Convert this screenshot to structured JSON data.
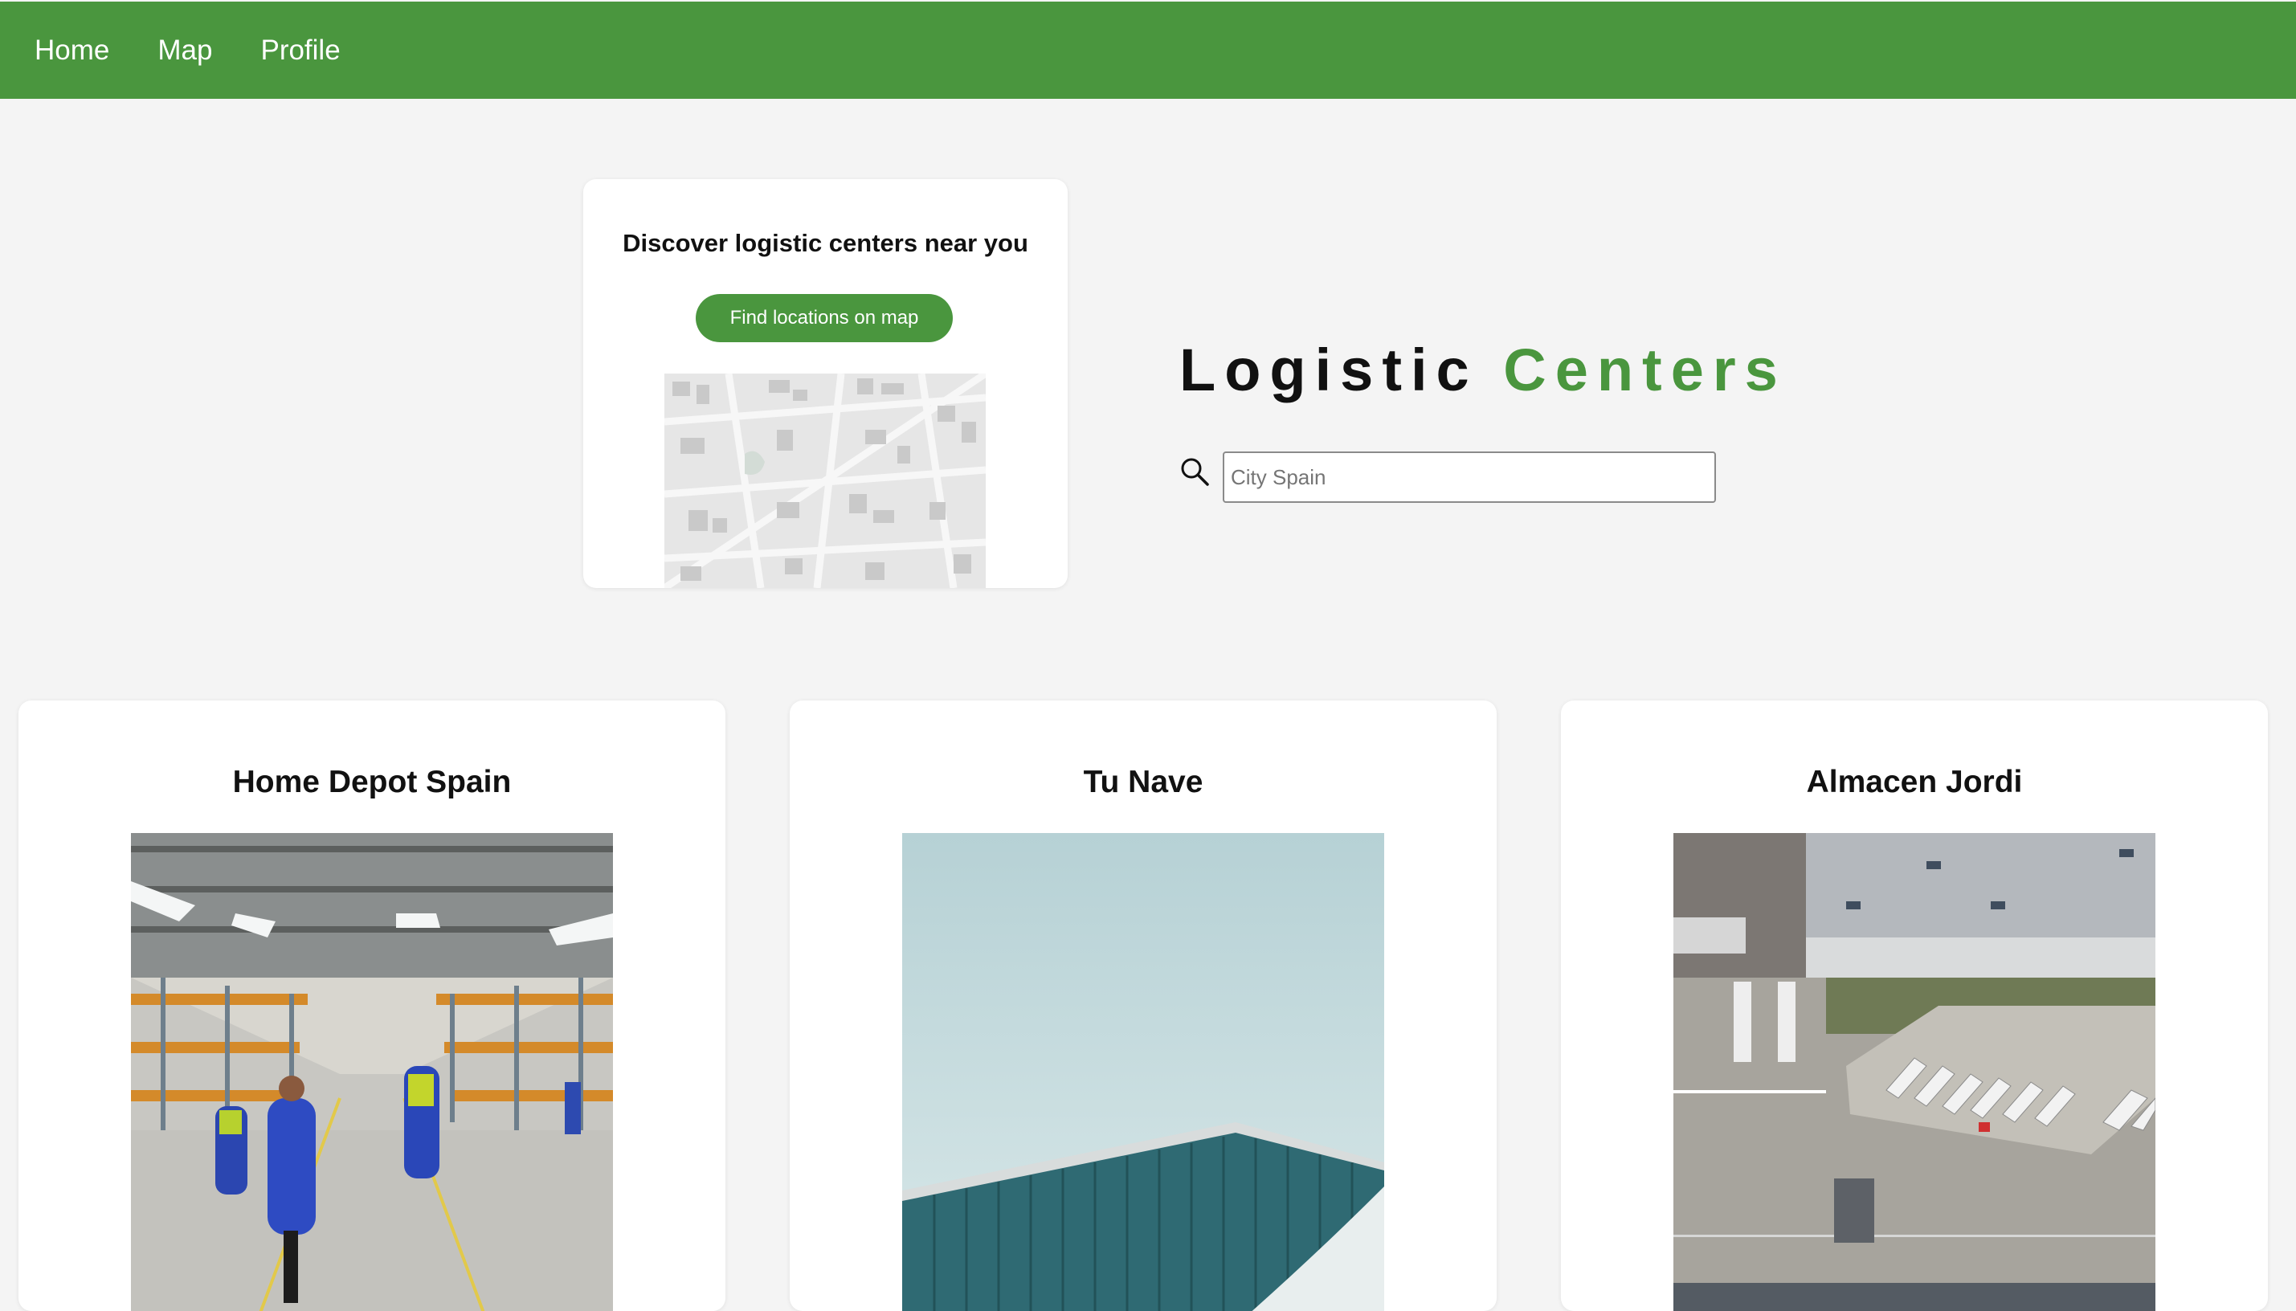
{
  "nav": {
    "items": [
      {
        "label": "Home"
      },
      {
        "label": "Map"
      },
      {
        "label": "Profile"
      }
    ]
  },
  "promo": {
    "title": "Discover logistic centers near you",
    "button_label": "Find locations on map"
  },
  "hero": {
    "title_dark": "Logistic",
    "title_green": "Centers"
  },
  "search": {
    "placeholder": "City Spain",
    "value": ""
  },
  "centers": [
    {
      "name": "Home Depot Spain"
    },
    {
      "name": "Tu Nave"
    },
    {
      "name": "Almacen Jordi"
    }
  ],
  "colors": {
    "brand_green": "#4a963e",
    "background": "#f4f4f4",
    "card": "#ffffff"
  },
  "icons": {
    "search": "search-icon"
  }
}
